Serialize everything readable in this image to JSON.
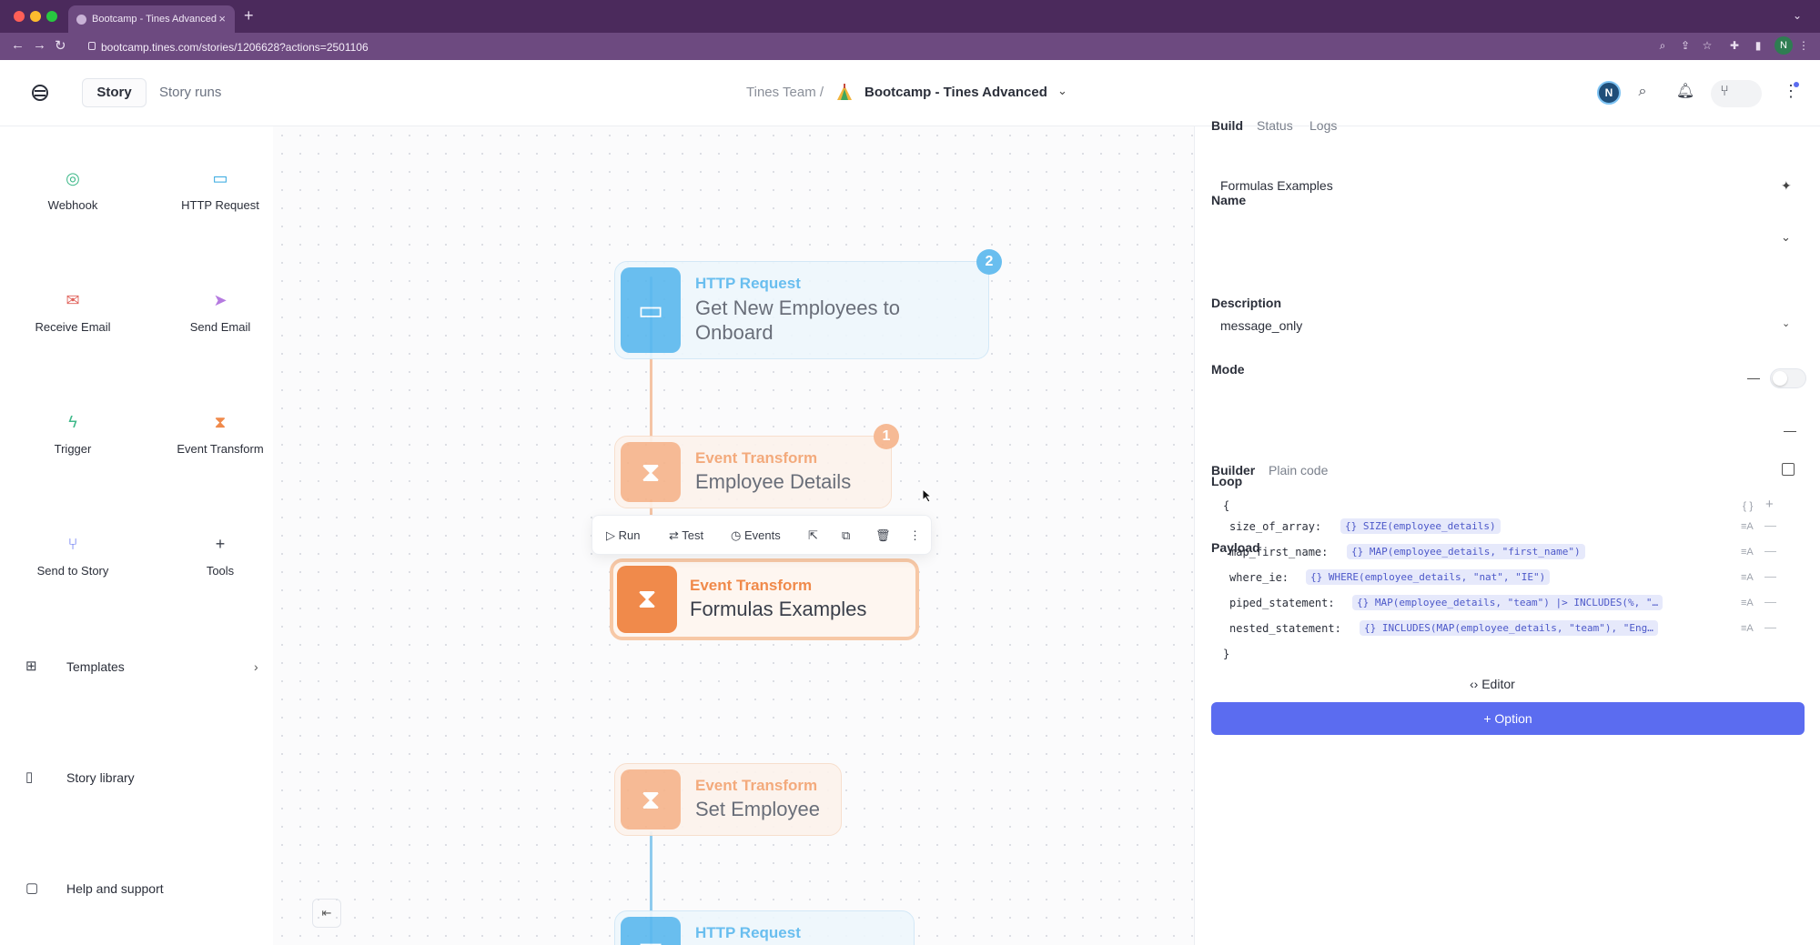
{
  "browser": {
    "tab_title": "Bootcamp - Tines Advanced",
    "url": "bootcamp.tines.com/stories/1206628?actions=2501106",
    "profile_initial": "N"
  },
  "header": {
    "tabs": [
      "Story",
      "Story runs"
    ],
    "team": "Tines Team",
    "separator": "/",
    "story_title": "Bootcamp - Tines Advanced",
    "avatar_initial": "N"
  },
  "sidebar": {
    "tools": [
      {
        "label": "Webhook",
        "icon": "webhook-icon",
        "color": "#3fb98a"
      },
      {
        "label": "HTTP Request",
        "icon": "monitor-icon",
        "color": "#36a9e0"
      },
      {
        "label": "Receive Email",
        "icon": "envelope-icon",
        "color": "#e0625b"
      },
      {
        "label": "Send Email",
        "icon": "send-icon",
        "color": "#b57ae0"
      },
      {
        "label": "Trigger",
        "icon": "bolt-icon",
        "color": "#3fb98a"
      },
      {
        "label": "Event Transform",
        "icon": "hourglass-icon",
        "color": "#f08a4b"
      },
      {
        "label": "Send to Story",
        "icon": "branch-icon",
        "color": "#5b6cf0"
      },
      {
        "label": "Tools",
        "icon": "plus-icon",
        "color": "#3a3f4a"
      }
    ],
    "links": [
      {
        "label": "Templates",
        "icon": "grid-icon"
      },
      {
        "label": "Story library",
        "icon": "book-icon"
      },
      {
        "label": "Help and support",
        "icon": "chat-icon"
      }
    ]
  },
  "canvas": {
    "nodes": [
      {
        "type": "HTTP Request",
        "name": "Get New Employees to Onboard",
        "badge": "2",
        "color": "#36a9e0"
      },
      {
        "type": "Event Transform",
        "name": "Employee Details",
        "badge": "1",
        "color": "#f08a4b"
      },
      {
        "type": "Event Transform",
        "name": "Formulas Examples",
        "badge": "",
        "color": "#f08a4b"
      },
      {
        "type": "Event Transform",
        "name": "Set Employee",
        "badge": "",
        "color": "#f08a4b"
      },
      {
        "type": "HTTP Request",
        "name": "",
        "badge": "",
        "color": "#36a9e0"
      }
    ],
    "action_bar": {
      "run": "Run",
      "test": "Test",
      "events": "Events"
    }
  },
  "panel": {
    "tabs": [
      "Build",
      "Status",
      "Logs"
    ],
    "name_label": "Name",
    "name_value": "Formulas Examples",
    "description_label": "Description",
    "mode_label": "Mode",
    "mode_value": "message_only",
    "loop_label": "Loop",
    "payload_label": "Payload",
    "builder_tabs": [
      "Builder",
      "Plain code"
    ],
    "open_brace": "{",
    "close_brace": "}",
    "payload": [
      {
        "key": "size_of_array",
        "value": "SIZE(employee_details)"
      },
      {
        "key": "map_first_name",
        "value": "MAP(employee_details, \"first_name\")"
      },
      {
        "key": "where_ie",
        "value": "WHERE(employee_details, \"nat\", \"IE\")"
      },
      {
        "key": "piped_statement",
        "value": "MAP(employee_details, \"team\") |> INCLUDES(%, \"…"
      },
      {
        "key": "nested_statement",
        "value": "INCLUDES(MAP(employee_details, \"team\"), \"Eng…"
      }
    ],
    "editor_label": "Editor",
    "option_label": "Option"
  },
  "colors": {
    "accent": "#5b6cf0",
    "browser_chrome": "#4b2a5c",
    "http_blue": "#36a9e0",
    "transform_orange": "#f08a4b"
  }
}
